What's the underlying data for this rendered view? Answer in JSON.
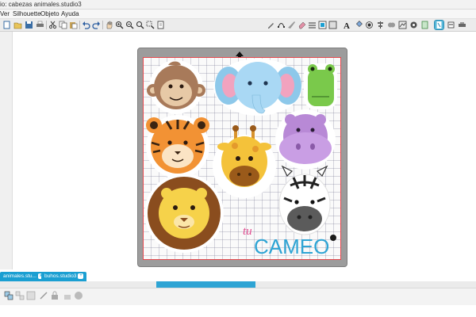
{
  "window": {
    "title": "io: cabezas animales.studio3"
  },
  "menu": {
    "items": [
      "Ver",
      "Silhouette",
      "Objeto",
      "Ayuda"
    ]
  },
  "toolbar": {
    "left": [
      "new-document",
      "open-file",
      "save-file",
      "print",
      "cut",
      "copy",
      "paste",
      "undo",
      "redo",
      "pan-hand",
      "zoom-in",
      "zoom-out",
      "zoom-fit",
      "zoom-area",
      "fit-page"
    ],
    "right": [
      "draw-tool",
      "edit-points",
      "knife",
      "eraser",
      "line-style",
      "fill-color",
      "text-tool",
      "replicate",
      "offset",
      "align",
      "weld",
      "trace",
      "send-panel",
      "page-setup",
      "cut-settings",
      "send-to-cutter"
    ],
    "active": "cut-settings"
  },
  "watermark": {
    "brand_prefix": "tu",
    "brand_name": "CAMEO"
  },
  "tabs": [
    {
      "label": "animales.stu...",
      "close": "x"
    },
    {
      "label": "buhos.studio3",
      "close": "+"
    }
  ],
  "statusbar": {
    "tools": [
      "group",
      "ungroup",
      "compound",
      "release",
      "lock",
      "unlock"
    ]
  },
  "colors": {
    "accent": "#1a9fd2",
    "mat": "#9c9c9c",
    "grid_line": "#b4b4c8"
  }
}
